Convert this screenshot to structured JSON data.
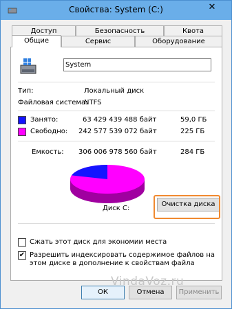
{
  "window": {
    "title": "Свойства: System (C:)",
    "close_glyph": "✕"
  },
  "tabs": {
    "row1": [
      "Доступ",
      "Безопасность",
      "Квота"
    ],
    "row2": [
      "Общие",
      "Сервис",
      "Оборудование"
    ],
    "active": "Общие"
  },
  "general": {
    "drive_name": "System",
    "type_label": "Тип:",
    "type_value": "Локальный диск",
    "fs_label": "Файловая система:",
    "fs_value": "NTFS",
    "used_label": "Занято:",
    "used_bytes": "63 429 439 488 байт",
    "used_size": "59,0 ГБ",
    "free_label": "Свободно:",
    "free_bytes": "242 577 539 072 байт",
    "free_size": "225 ГБ",
    "capacity_label": "Емкость:",
    "capacity_bytes": "306 006 978 560 байт",
    "capacity_size": "284 ГБ",
    "disk_label": "Диск C:",
    "cleanup_button": "Очистка диска",
    "compress_label": "Сжать этот диск для экономии места",
    "index_label": "Разрешить индексировать содержимое файлов на этом диске в дополнение к свойствам файла",
    "used_fraction": 0.207,
    "used_color": "#1414ff",
    "free_color": "#ff00ff"
  },
  "checkboxes": {
    "compress_checked": false,
    "index_checked": true
  },
  "footer": {
    "ok": "ОК",
    "cancel": "Отмена",
    "apply": "Применить"
  },
  "watermark": "VindaVoz.ru"
}
